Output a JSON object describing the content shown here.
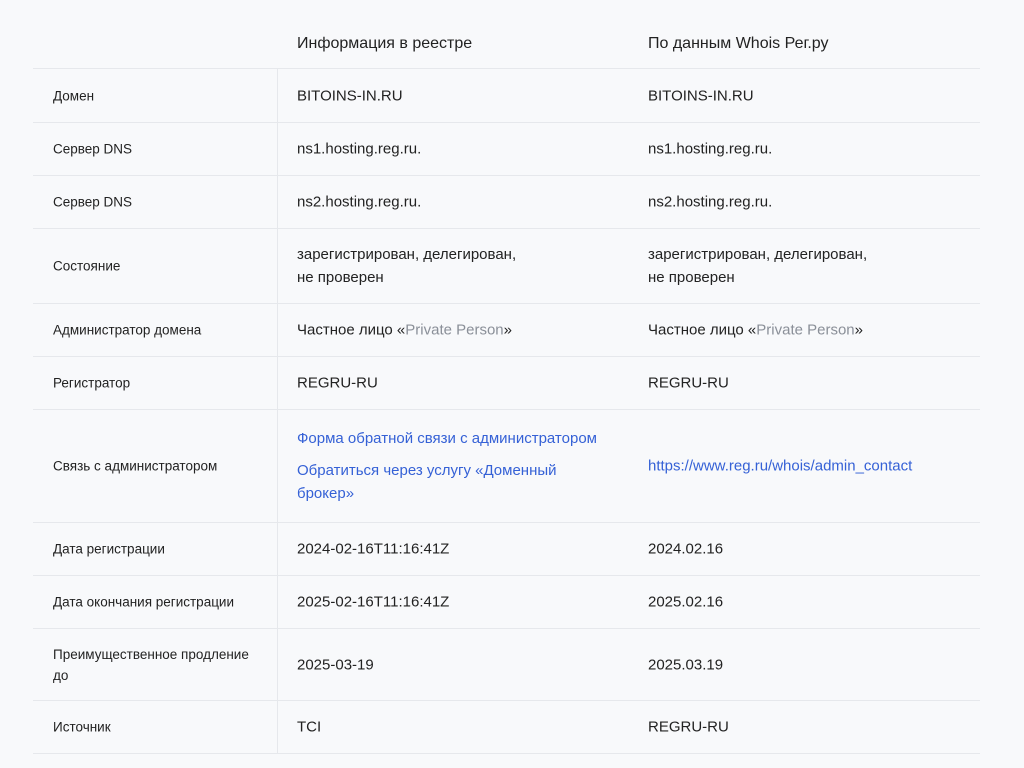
{
  "header": {
    "col_registry": "Информация в реестре",
    "col_whois": "По данным Whois Рег.ру"
  },
  "rows": {
    "domain": {
      "label": "Домен",
      "registry": "BITOINS-IN.RU",
      "whois": "BITOINS-IN.RU"
    },
    "dns1": {
      "label": "Сервер DNS",
      "registry": "ns1.hosting.reg.ru.",
      "whois": "ns1.hosting.reg.ru."
    },
    "dns2": {
      "label": "Сервер DNS",
      "registry": "ns2.hosting.reg.ru.",
      "whois": "ns2.hosting.reg.ru."
    },
    "state": {
      "label": "Состояние",
      "registry_line1": "зарегистрирован, делегирован,",
      "registry_line2": "не проверен",
      "whois_line1": "зарегистрирован, делегирован,",
      "whois_line2": "не проверен"
    },
    "admin": {
      "label": "Администратор домена",
      "registry_prefix": "Частное лицо «",
      "registry_name": "Private Person",
      "registry_suffix": "»",
      "whois_prefix": "Частное лицо «",
      "whois_name": "Private Person",
      "whois_suffix": "»"
    },
    "registrar": {
      "label": "Регистратор",
      "registry": "REGRU-RU",
      "whois": "REGRU-RU"
    },
    "contact": {
      "label": "Связь с администратором",
      "registry_link1": "Форма обратной связи с администратором",
      "registry_link2_line1": "Обратиться через услугу «Доменный",
      "registry_link2_line2": "брокер»",
      "whois_link": "https://www.reg.ru/whois/admin_contact"
    },
    "reg_date": {
      "label": "Дата регистрации",
      "registry": "2024-02-16T11:16:41Z",
      "whois": "2024.02.16"
    },
    "exp_date": {
      "label": "Дата окончания регистрации",
      "registry": "2025-02-16T11:16:41Z",
      "whois": "2025.02.16"
    },
    "renewal": {
      "label_line1": "Преимущественное продление",
      "label_line2": "до",
      "registry": "2025-03-19",
      "whois": "2025.03.19"
    },
    "source": {
      "label": "Источник",
      "registry": "TCI",
      "whois": "REGRU-RU"
    }
  },
  "colors": {
    "link": "#3561d6",
    "muted": "#8a8f98",
    "divider": "#e6e8ec",
    "background": "#f8f9fb"
  }
}
